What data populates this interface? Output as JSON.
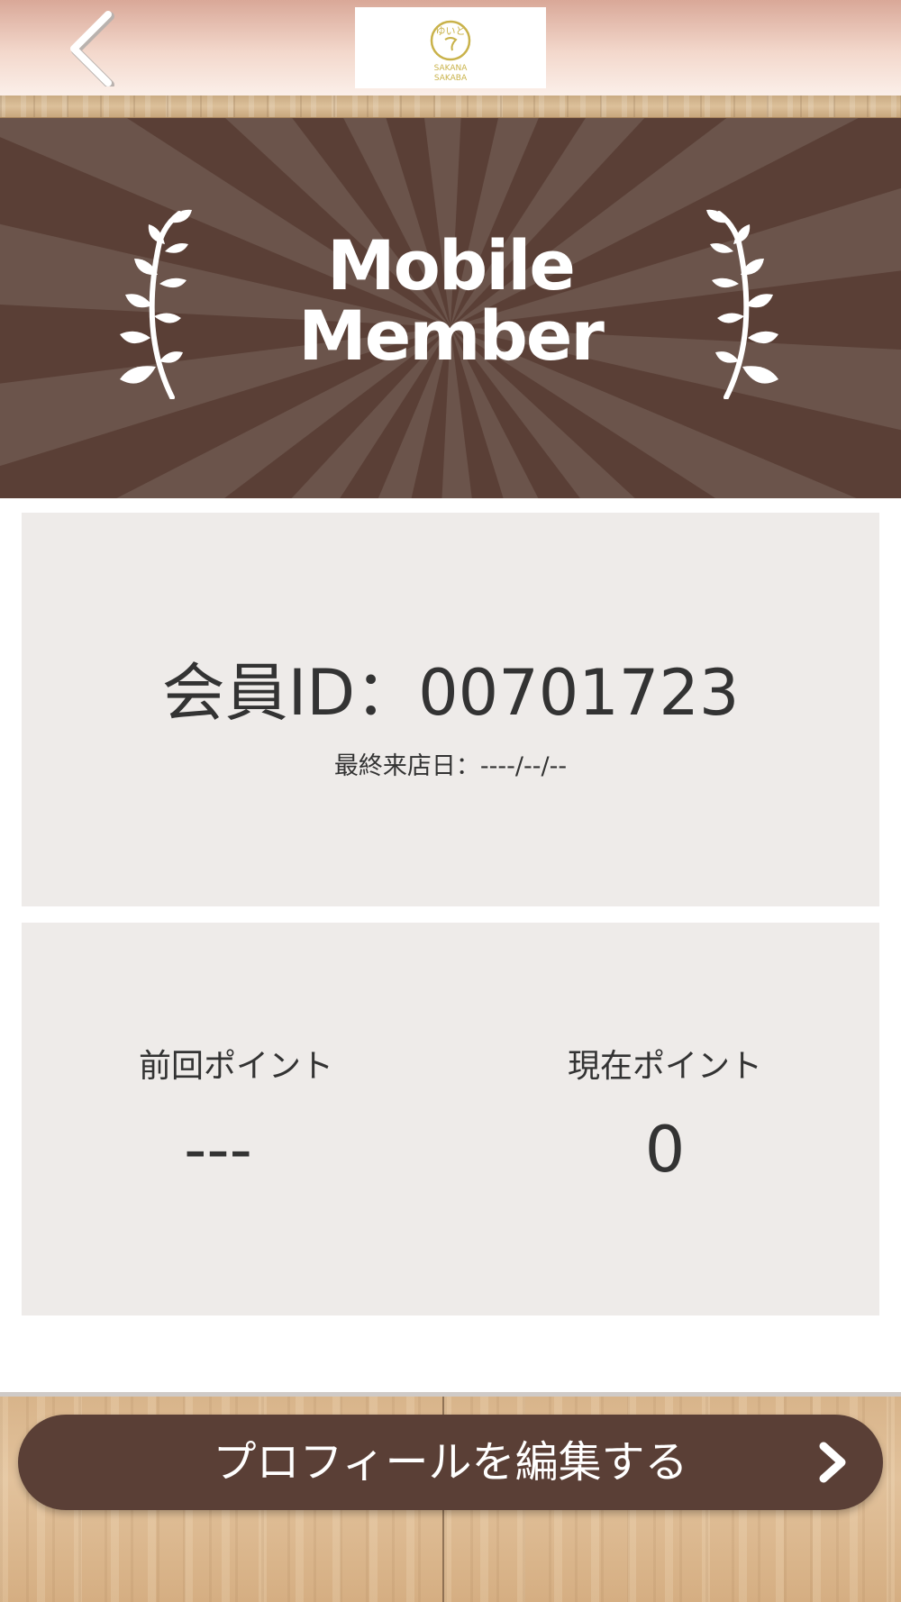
{
  "header": {
    "back_icon": "chevron-left-icon",
    "logo": {
      "script": "ゆいと",
      "line1": "SAKANA",
      "line2": "SAKABA",
      "color": "#c9b24a"
    }
  },
  "banner": {
    "title_line1": "Mobile",
    "title_line2": "Member",
    "background": "#5a3f36",
    "ray_color": "#6b544b",
    "icons": [
      "laurel-left-icon",
      "laurel-right-icon"
    ]
  },
  "member": {
    "id_text": "会員ID：00701723",
    "last_visit_text": "最終来店日：----/--/--"
  },
  "points": {
    "previous_label": "前回ポイント",
    "previous_value": "---",
    "current_label": "現在ポイント",
    "current_value": "0"
  },
  "footer": {
    "edit_profile_label": "プロフィールを編集する",
    "button_color": "#5a3f36",
    "chevron_icon": "chevron-right-icon"
  }
}
